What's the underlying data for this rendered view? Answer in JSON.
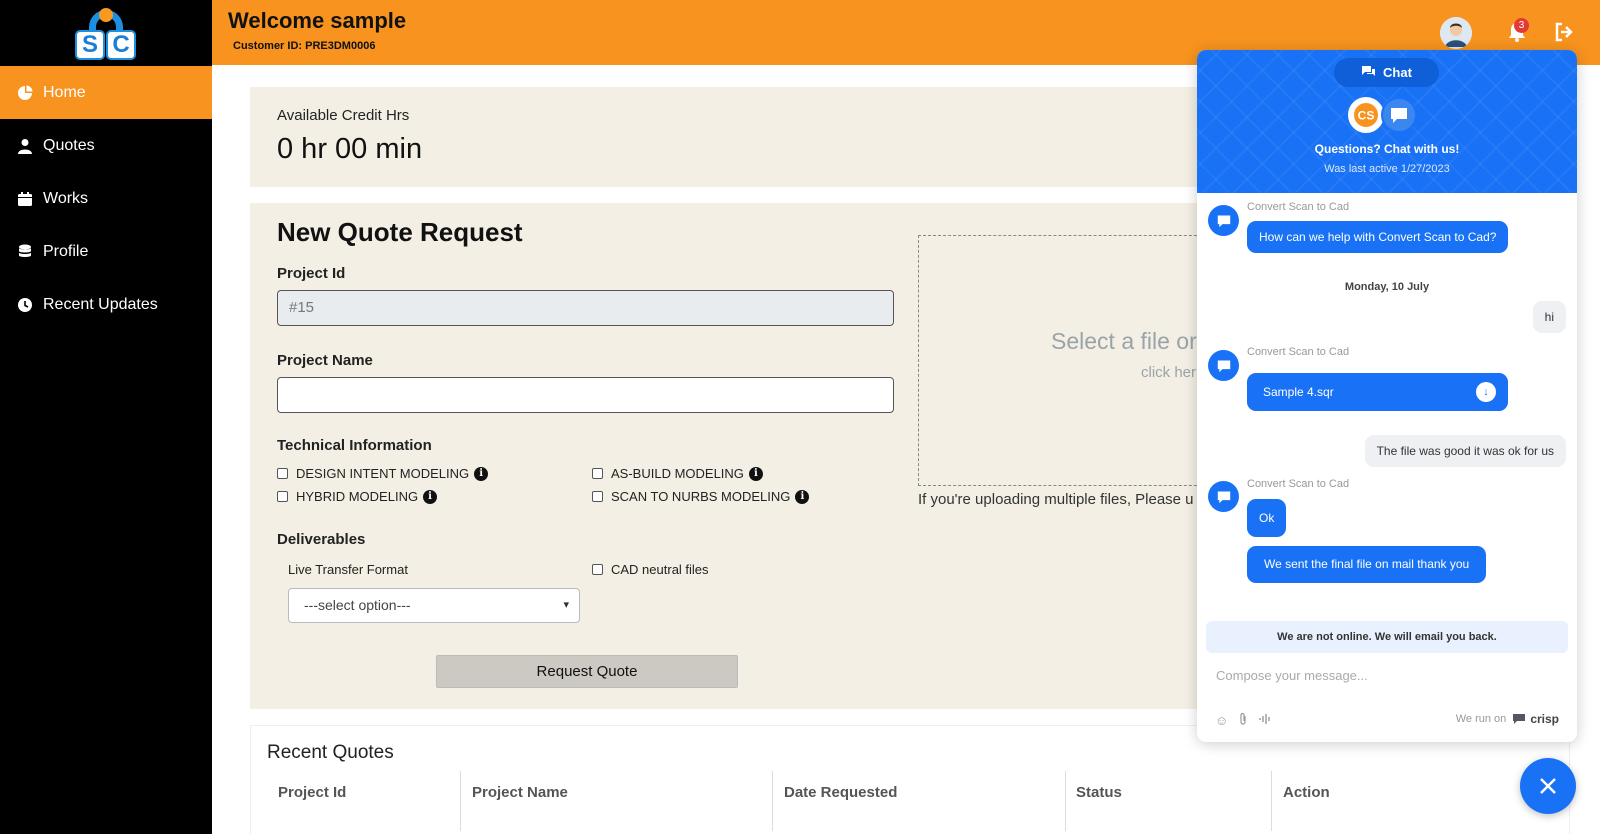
{
  "header": {
    "title": "Welcome sample",
    "customer_id": "Customer ID: PRE3DM0006",
    "notification_count": "3"
  },
  "sidebar": {
    "items": [
      {
        "label": "Home",
        "icon": "pie-chart-icon",
        "active": true
      },
      {
        "label": "Quotes",
        "icon": "user-icon"
      },
      {
        "label": "Works",
        "icon": "calendar-icon"
      },
      {
        "label": "Profile",
        "icon": "database-icon"
      },
      {
        "label": "Recent Updates",
        "icon": "clock-icon"
      }
    ]
  },
  "credit": {
    "label": "Available Credit Hrs",
    "value": "0 hr 00 min"
  },
  "quote_form": {
    "title": "New Quote Request",
    "project_id_label": "Project Id",
    "project_id_value": "#15",
    "project_name_label": "Project Name",
    "project_name_value": "",
    "technical_label": "Technical Information",
    "technical_options": [
      "DESIGN INTENT MODELING",
      "AS-BUILD MODELING",
      "HYBRID MODELING",
      "SCAN TO NURBS MODELING"
    ],
    "deliverables_label": "Deliverables",
    "live_transfer_label": "Live Transfer Format",
    "select_value": "---select option---",
    "cad_neutral_label": "CAD neutral files",
    "submit_label": "Request Quote",
    "dropzone_title": "Select a file or",
    "dropzone_sub": "click her",
    "upload_note": "If you're uploading multiple files, Please u"
  },
  "recent_quotes": {
    "title": "Recent Quotes",
    "columns": [
      "Project Id",
      "Project Name",
      "Date Requested",
      "Status",
      "Action"
    ]
  },
  "chat": {
    "tab_label": "Chat",
    "headline": "Questions? Chat with us!",
    "last_active": "Was last active 1/27/2023",
    "agent_name": "Convert Scan to Cad",
    "messages": {
      "m1": "How can we help with Convert Scan to Cad?",
      "date": "Monday, 10 July",
      "m2": "hi",
      "file": "Sample 4.sqr",
      "m3": "The file was good it was ok for us",
      "m4": "Ok",
      "m5": "We sent the final file on mail thank you"
    },
    "offline_notice": "We are not online. We will email you back.",
    "compose_placeholder": "Compose your message...",
    "powered_by": "We run on",
    "brand": "crisp",
    "accent_color": "#1972f5"
  },
  "colors": {
    "brand_orange": "#f7931e",
    "sidebar_bg": "#000000",
    "card_bg": "#f3efe5"
  }
}
